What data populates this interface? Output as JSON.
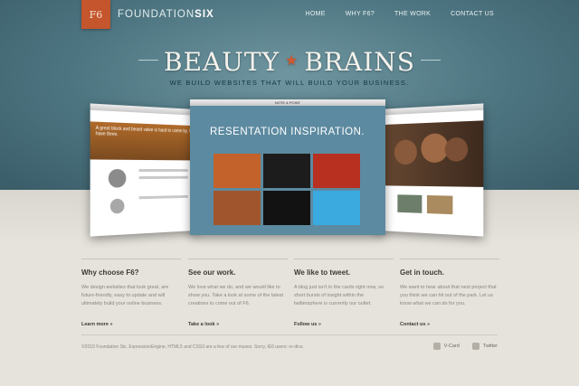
{
  "header": {
    "badge": "F6",
    "brand_prefix": "FOUNDATION",
    "brand_suffix": "SIX",
    "nav": [
      "HOME",
      "WHY F6?",
      "THE WORK",
      "CONTACT US"
    ]
  },
  "hero": {
    "headline_left": "BEAUTY",
    "headline_star": "★",
    "headline_right": "BRAINS",
    "tagline": "WE BUILD WEBSITES THAT WILL BUILD YOUR BUSINESS."
  },
  "showcase": {
    "center_title": "NOTE & POINT",
    "center_heading": "RESENTATION INSPIRATION.",
    "left_blurb": "A great block and beard valve is hard to come by. We have three."
  },
  "columns": [
    {
      "title": "Why choose F6?",
      "body": "We design websites that look great, are future-friendly, easy to update and will ultimately build your online business.",
      "link": "Learn more »"
    },
    {
      "title": "See our work.",
      "body": "We love what we do, and we would like to show you. Take a look at some of the latest creations to come out of F6.",
      "link": "Take a look »"
    },
    {
      "title": "We like to tweet.",
      "body": "A blog just isn't in the cards right now, so short bursts of insight within the twittersphere is currently our outlet.",
      "link": "Follow us »"
    },
    {
      "title": "Get in touch.",
      "body": "We want to hear about that next project that you think we can hit out of the park. Let us know what we can do for you.",
      "link": "Contact us »"
    }
  ],
  "footer": {
    "copyright": "©2010 Foundation Six. ExpressionEngine, HTML5 and CSS3 are a few of our muses. Sorry, IE6 users: re-dice.",
    "vcard": "V-Card",
    "twitter": "Twitter"
  },
  "colors": {
    "accent": "#c4552c",
    "hero": "#4c7480",
    "page": "#e6e3dc"
  }
}
